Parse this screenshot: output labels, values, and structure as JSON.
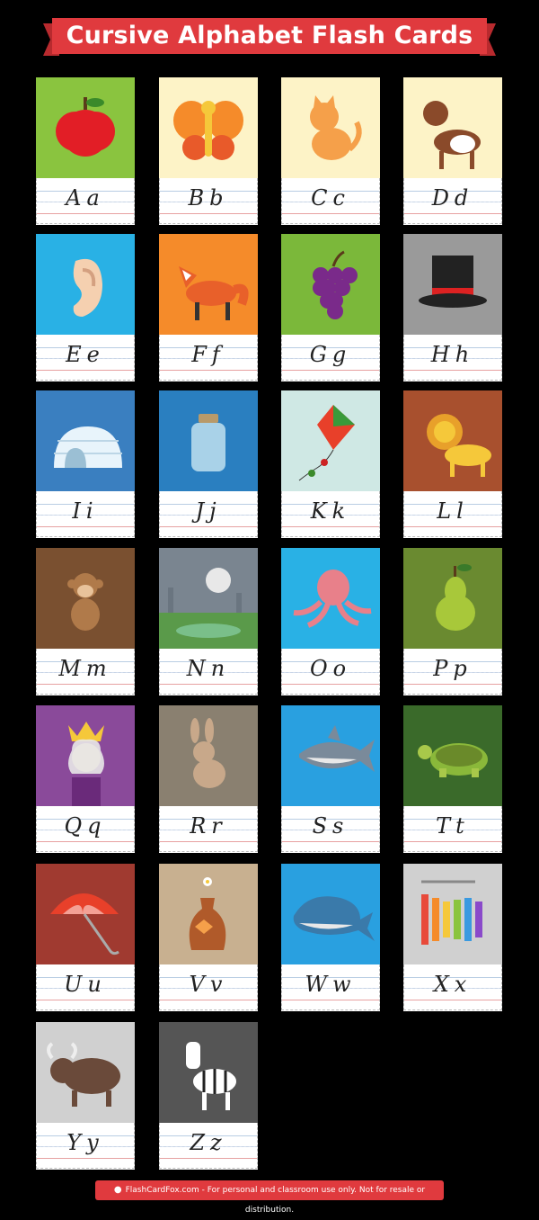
{
  "title": "Cursive Alphabet Flash Cards",
  "footer": {
    "text": "FlashCardFox.com - For personal and classroom use only. Not for resale or distribution.",
    "icon": "paw-icon"
  },
  "colors": {
    "banner": "#e03a3e",
    "background": "#000000"
  },
  "cards": [
    {
      "letter": "Aa",
      "picture": "apple",
      "bg": "#8ac43f"
    },
    {
      "letter": "Bb",
      "picture": "butterfly",
      "bg": "#fdf3c7"
    },
    {
      "letter": "Cc",
      "picture": "cat",
      "bg": "#fdf3c7"
    },
    {
      "letter": "Dd",
      "picture": "dog",
      "bg": "#fdf3c7"
    },
    {
      "letter": "Ee",
      "picture": "ear",
      "bg": "#29b1e5"
    },
    {
      "letter": "Ff",
      "picture": "fox",
      "bg": "#f58b2a"
    },
    {
      "letter": "Gg",
      "picture": "grapes",
      "bg": "#7bb83a"
    },
    {
      "letter": "Hh",
      "picture": "hat",
      "bg": "#9a9a9a"
    },
    {
      "letter": "Ii",
      "picture": "igloo",
      "bg": "#3a7fc0"
    },
    {
      "letter": "Jj",
      "picture": "jar",
      "bg": "#2a7fc0"
    },
    {
      "letter": "Kk",
      "picture": "kite",
      "bg": "#cfe8e4"
    },
    {
      "letter": "Ll",
      "picture": "lion",
      "bg": "#a8502e"
    },
    {
      "letter": "Mm",
      "picture": "monkey",
      "bg": "#7a5030"
    },
    {
      "letter": "Nn",
      "picture": "night",
      "bg": "#7a8590"
    },
    {
      "letter": "Oo",
      "picture": "octopus",
      "bg": "#29b1e5"
    },
    {
      "letter": "Pp",
      "picture": "pear",
      "bg": "#6a8a30"
    },
    {
      "letter": "Qq",
      "picture": "queen",
      "bg": "#8a4a9a"
    },
    {
      "letter": "Rr",
      "picture": "rabbit",
      "bg": "#8a8070"
    },
    {
      "letter": "Ss",
      "picture": "shark",
      "bg": "#29a0e0"
    },
    {
      "letter": "Tt",
      "picture": "turtle",
      "bg": "#3a6a2a"
    },
    {
      "letter": "Uu",
      "picture": "umbrella",
      "bg": "#a03a30"
    },
    {
      "letter": "Vv",
      "picture": "vase",
      "bg": "#c8b090"
    },
    {
      "letter": "Ww",
      "picture": "whale",
      "bg": "#29a0e0"
    },
    {
      "letter": "Xx",
      "picture": "xylophone",
      "bg": "#d0d0d0"
    },
    {
      "letter": "Yy",
      "picture": "yak",
      "bg": "#d0d0d0"
    },
    {
      "letter": "Zz",
      "picture": "zebra",
      "bg": "#555555"
    }
  ]
}
